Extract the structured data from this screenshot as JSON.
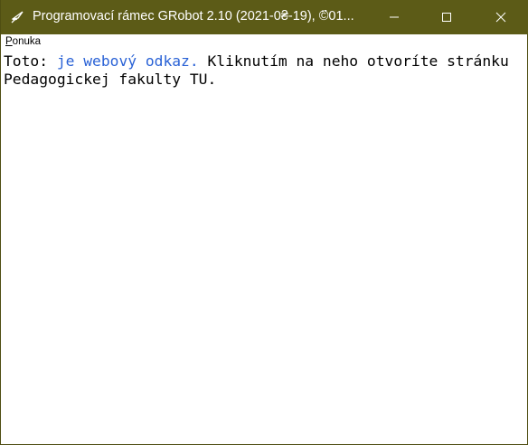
{
  "window": {
    "title": "Programovací rámec GRobot 2.10 (2021-0₴-19), ©፟01...",
    "icon": "grobot-app-icon",
    "buttons": {
      "minimize_icon": "minimize-icon",
      "maximize_icon": "maximize-icon",
      "close_icon": "close-icon"
    }
  },
  "menu": {
    "items": [
      {
        "accel": "P",
        "rest": "onuka"
      }
    ]
  },
  "content": {
    "prefix": "Toto: ",
    "link_text": "je webový odkaz.",
    "suffix": " Kliknutím na neho otvoríte stránku Pedagogickej fakulty TU."
  },
  "colors": {
    "titlebar": "#5c5b17",
    "link": "#2a62d6",
    "client_bg": "#ffffff"
  }
}
